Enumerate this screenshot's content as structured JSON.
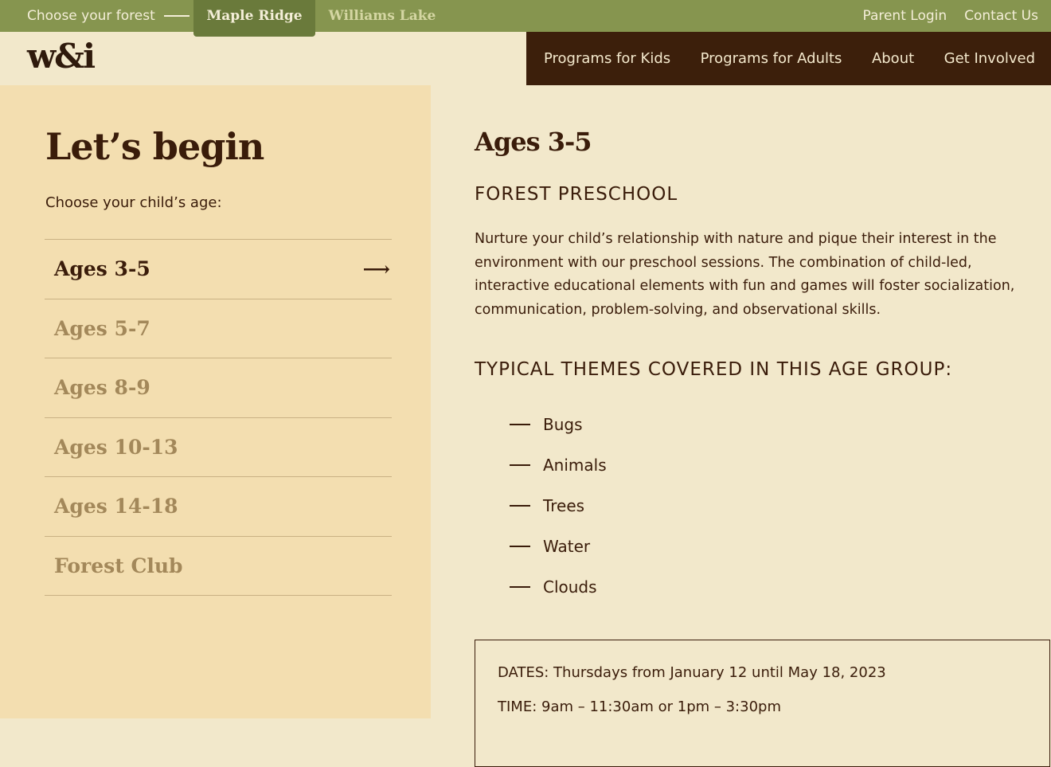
{
  "topbar": {
    "choose_label": "Choose your forest",
    "forests": [
      {
        "label": "Maple Ridge",
        "active": true
      },
      {
        "label": "Williams Lake",
        "active": false
      }
    ],
    "utility_links": [
      "Parent Login",
      "Contact Us"
    ]
  },
  "header": {
    "logo": "w&i",
    "nav": [
      "Programs for Kids",
      "Programs for Adults",
      "About",
      "Get Involved"
    ]
  },
  "sidebar": {
    "title": "Let’s begin",
    "prompt": "Choose your child’s age:",
    "ages": [
      {
        "label": "Ages 3-5",
        "active": true
      },
      {
        "label": "Ages 5-7",
        "active": false
      },
      {
        "label": "Ages 8-9",
        "active": false
      },
      {
        "label": "Ages 10-13",
        "active": false
      },
      {
        "label": "Ages 14-18",
        "active": false
      },
      {
        "label": "Forest Club",
        "active": false
      }
    ],
    "arrow": "⟶"
  },
  "content": {
    "title": "Ages 3-5",
    "program": "FOREST PRESCHOOL",
    "description": "Nurture your child’s relationship with nature and pique their interest in the environment with our preschool sessions. The combination of child-led, interactive educational elements with fun and games will foster socialization, communication, problem-solving, and observational skills.",
    "themes_title": "TYPICAL THEMES COVERED IN THIS AGE GROUP:",
    "themes": [
      "Bugs",
      "Animals",
      "Trees",
      "Water",
      "Clouds"
    ],
    "info": {
      "dates": "DATES: Thursdays from January 12 until May 18, 2023",
      "time": "TIME: 9am – 11:30am or 1pm – 3:30pm"
    }
  },
  "colors": {
    "topbar": "#86954f",
    "forest_active": "#6a7a3b",
    "nav": "#3c1f0b",
    "sidebar": "#f3deb0",
    "page": "#f2e8cb",
    "text": "#3a1c0a",
    "muted": "#a3885a"
  }
}
